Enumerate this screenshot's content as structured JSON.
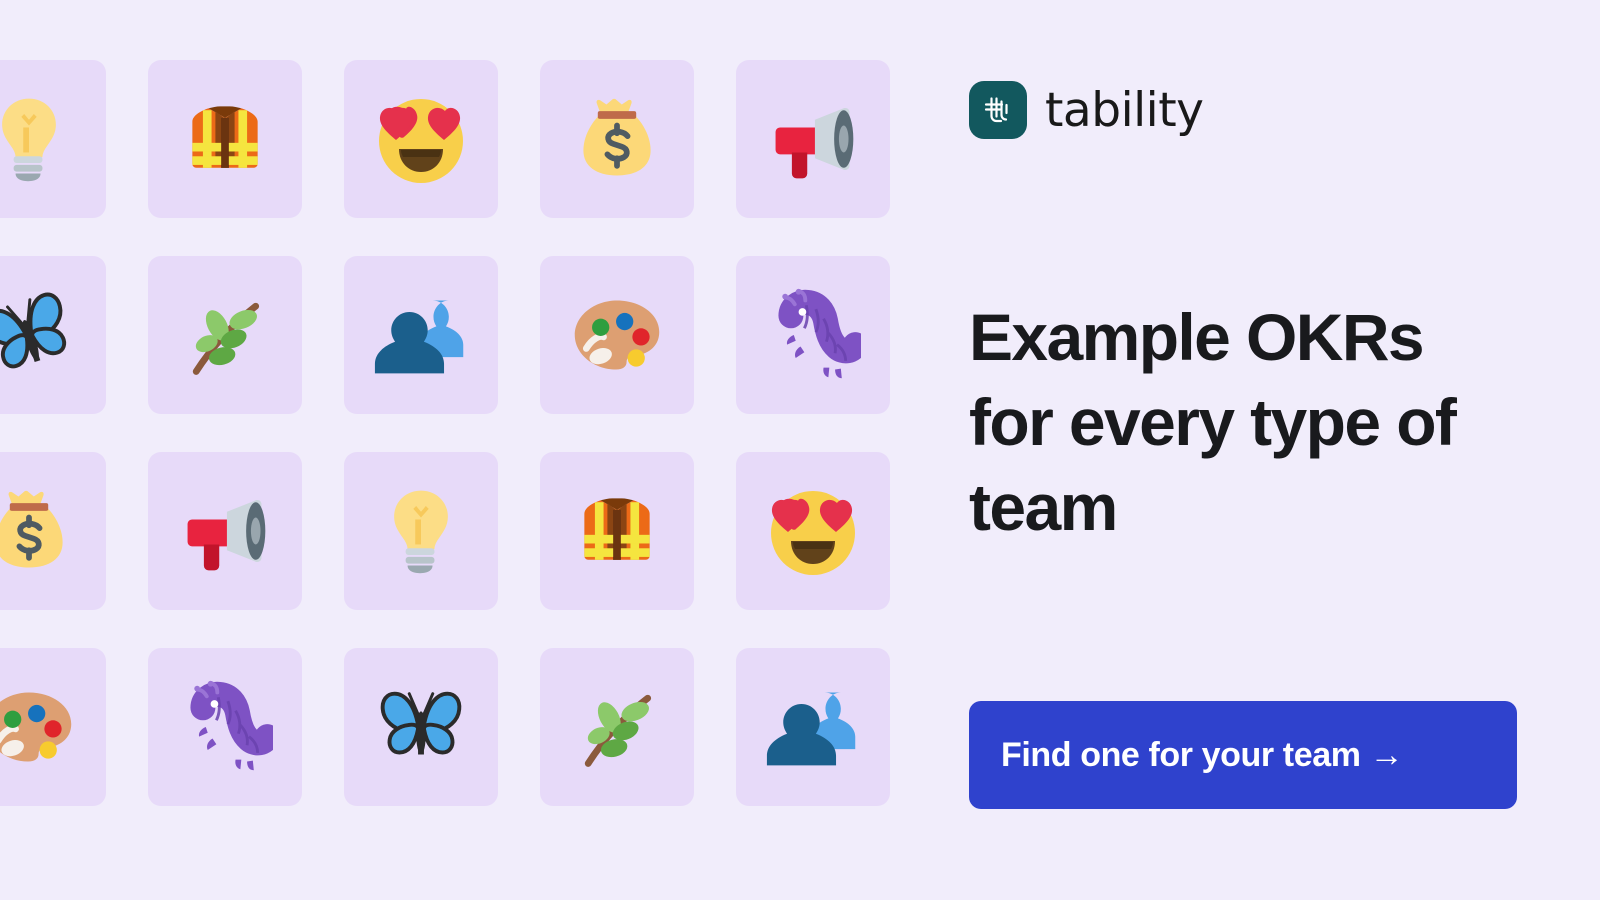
{
  "page": {
    "background_color": "#f1edfb",
    "tile_color": "#e7daf9"
  },
  "brand": {
    "name": "tability",
    "mark_icon": "tability-logo-icon",
    "mark_color": "#12585e"
  },
  "headline": {
    "text": "Example OKRs for every type of team",
    "color": "#191a1d"
  },
  "cta": {
    "label": "Find one for your team →",
    "background_color": "#2f42cd",
    "text_color": "#ffffff"
  },
  "tile_grid": {
    "columns": 5,
    "rows": 4,
    "tiles": [
      {
        "icon": "light-bulb-icon",
        "emoji": "💡",
        "label": "light bulb"
      },
      {
        "icon": "safety-vest-icon",
        "emoji": "🦺",
        "label": "safety vest"
      },
      {
        "icon": "smiling-face-with-hearts-icon",
        "emoji": "😍",
        "label": "smiling face with heart-eyes"
      },
      {
        "icon": "money-bag-icon",
        "emoji": "💰",
        "label": "money bag"
      },
      {
        "icon": "megaphone-icon",
        "emoji": "📣",
        "label": "megaphone"
      },
      {
        "icon": "butterfly-icon",
        "emoji": "🦋",
        "label": "butterfly"
      },
      {
        "icon": "herb-icon",
        "emoji": "🌿",
        "label": "herb"
      },
      {
        "icon": "busts-in-silhouette-icon",
        "emoji": "👥",
        "label": "busts in silhouette"
      },
      {
        "icon": "artist-palette-icon",
        "emoji": "🎨",
        "label": "artist palette"
      },
      {
        "icon": "caterpillar-icon",
        "emoji": "🐛",
        "label": "caterpillar"
      },
      {
        "icon": "money-bag-icon",
        "emoji": "💰",
        "label": "money bag"
      },
      {
        "icon": "megaphone-icon",
        "emoji": "📣",
        "label": "megaphone"
      },
      {
        "icon": "light-bulb-icon",
        "emoji": "💡",
        "label": "light bulb"
      },
      {
        "icon": "safety-vest-icon",
        "emoji": "🦺",
        "label": "safety vest"
      },
      {
        "icon": "smiling-face-with-hearts-icon",
        "emoji": "😍",
        "label": "smiling face with heart-eyes"
      },
      {
        "icon": "artist-palette-icon",
        "emoji": "🎨",
        "label": "artist palette"
      },
      {
        "icon": "caterpillar-icon",
        "emoji": "🐛",
        "label": "caterpillar"
      },
      {
        "icon": "butterfly-icon",
        "emoji": "🦋",
        "label": "butterfly"
      },
      {
        "icon": "herb-icon",
        "emoji": "🌿",
        "label": "herb"
      },
      {
        "icon": "busts-in-silhouette-icon",
        "emoji": "👥",
        "label": "busts in silhouette"
      }
    ]
  }
}
